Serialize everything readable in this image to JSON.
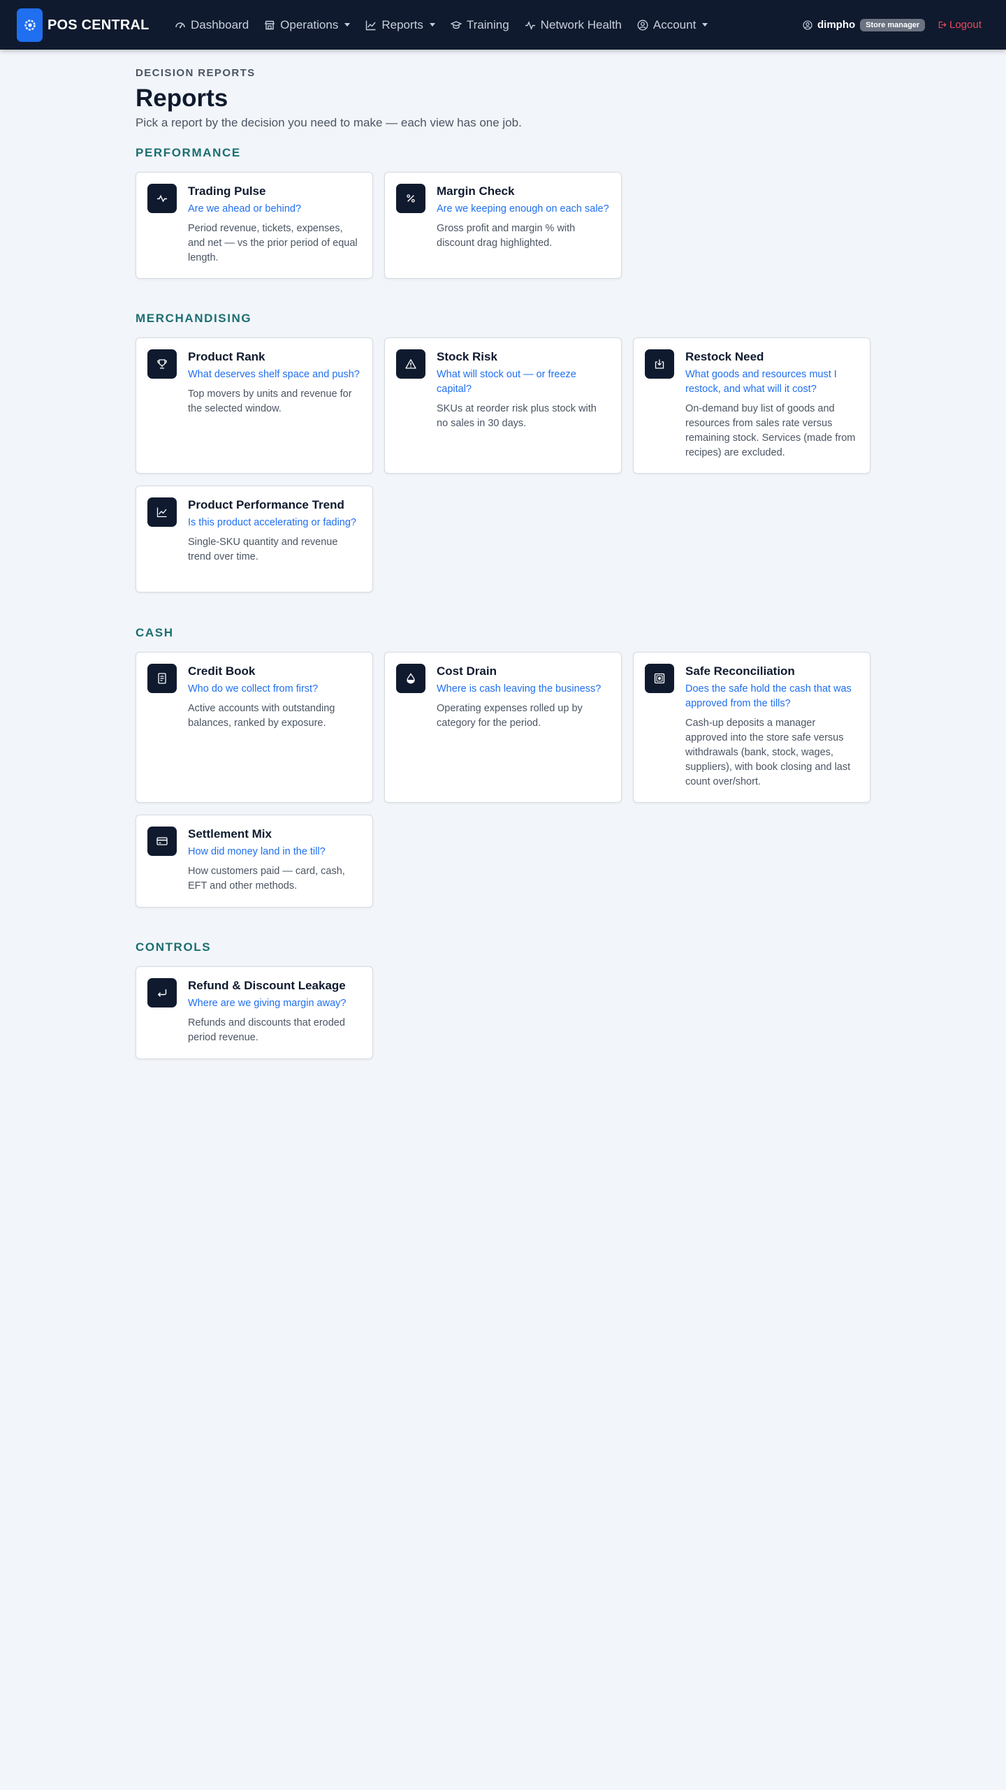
{
  "nav": {
    "brand": "POS CENTRAL",
    "items": [
      {
        "label": "Dashboard",
        "icon": "speedometer-icon",
        "dropdown": false
      },
      {
        "label": "Operations",
        "icon": "shop-icon",
        "dropdown": true
      },
      {
        "label": "Reports",
        "icon": "graph-up-icon",
        "dropdown": true
      },
      {
        "label": "Training",
        "icon": "mortarboard-icon",
        "dropdown": false
      },
      {
        "label": "Network Health",
        "icon": "activity-icon",
        "dropdown": false
      },
      {
        "label": "Account",
        "icon": "person-circle-icon",
        "dropdown": true
      }
    ],
    "user": {
      "name": "dimpho",
      "role": "Store manager"
    },
    "logout": "Logout"
  },
  "header": {
    "eyebrow": "DECISION REPORTS",
    "title": "Reports",
    "subtitle": "Pick a report by the decision you need to make — each view has one job."
  },
  "sections": [
    {
      "title": "PERFORMANCE",
      "cards": [
        {
          "title": "Trading Pulse",
          "question": "Are we ahead or behind?",
          "description": "Period revenue, tickets, expenses, and net — vs the prior period of equal length.",
          "icon": "activity-icon"
        },
        {
          "title": "Margin Check",
          "question": "Are we keeping enough on each sale?",
          "description": "Gross profit and margin % with discount drag highlighted.",
          "icon": "percent-icon"
        }
      ]
    },
    {
      "title": "MERCHANDISING",
      "cards": [
        {
          "title": "Product Rank",
          "question": "What deserves shelf space and push?",
          "description": "Top movers by units and revenue for the selected window.",
          "icon": "trophy-icon"
        },
        {
          "title": "Stock Risk",
          "question": "What will stock out — or freeze capital?",
          "description": "SKUs at reorder risk plus stock with no sales in 30 days.",
          "icon": "warning-triangle-icon"
        },
        {
          "title": "Restock Need",
          "question": "What goods and resources must I restock, and what will it cost?",
          "description": "On-demand buy list of goods and resources from sales rate versus remaining stock. Services (made from recipes) are excluded.",
          "icon": "box-arrow-in-icon"
        },
        {
          "title": "Product Performance Trend",
          "question": "Is this product accelerating or fading?",
          "description": "Single-SKU quantity and revenue trend over time.",
          "icon": "graph-up-icon"
        }
      ]
    },
    {
      "title": "CASH",
      "cards": [
        {
          "title": "Credit Book",
          "question": "Who do we collect from first?",
          "description": "Active accounts with outstanding balances, ranked by exposure.",
          "icon": "journal-icon"
        },
        {
          "title": "Cost Drain",
          "question": "Where is cash leaving the business?",
          "description": "Operating expenses rolled up by category for the period.",
          "icon": "droplet-icon"
        },
        {
          "title": "Safe Reconciliation",
          "question": "Does the safe hold the cash that was approved from the tills?",
          "description": "Cash-up deposits a manager approved into the store safe versus withdrawals (bank, stock, wages, suppliers), with book closing and last count over/short.",
          "icon": "safe-icon"
        },
        {
          "title": "Settlement Mix",
          "question": "How did money land in the till?",
          "description": "How customers paid — card, cash, EFT and other methods.",
          "icon": "credit-card-icon"
        }
      ]
    },
    {
      "title": "CONTROLS",
      "cards": [
        {
          "title": "Refund & Discount Leakage",
          "question": "Where are we giving margin away?",
          "description": "Refunds and discounts that eroded period revenue.",
          "icon": "return-arrow-icon"
        }
      ]
    }
  ]
}
